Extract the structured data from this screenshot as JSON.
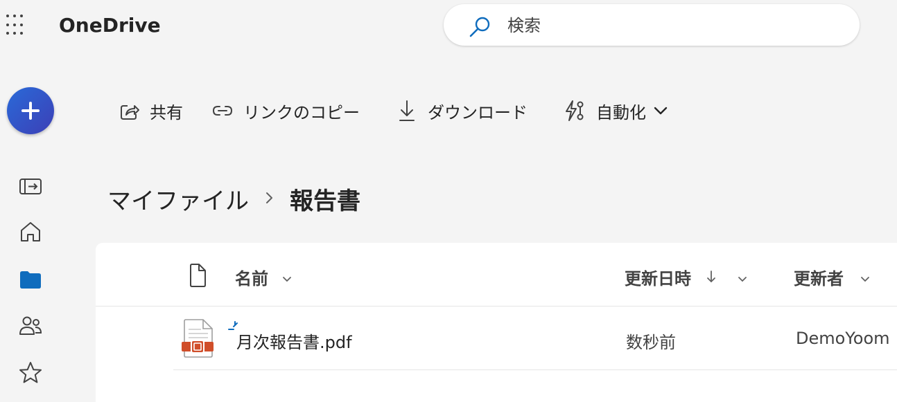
{
  "header": {
    "app_name": "OneDrive",
    "search_placeholder": "検索"
  },
  "rail": {
    "new_button": "plus-icon",
    "items": [
      "sidebar-expand-icon",
      "home-icon",
      "folder-icon",
      "people-icon",
      "star-icon"
    ]
  },
  "commands": {
    "share": "共有",
    "copy_link": "リンクのコピー",
    "download": "ダウンロード",
    "automate": "自動化"
  },
  "breadcrumb": {
    "root": "マイファイル",
    "current": "報告書"
  },
  "list": {
    "columns": {
      "name": "名前",
      "modified": "更新日時",
      "modified_by": "更新者"
    },
    "rows": [
      {
        "name": "月次報告書.pdf",
        "modified": "数秒前",
        "modified_by": "DemoYoom"
      }
    ]
  },
  "colors": {
    "accent": "#0f6cbd",
    "new_button": "#3558c9",
    "pdf_red": "#d04e2a"
  }
}
